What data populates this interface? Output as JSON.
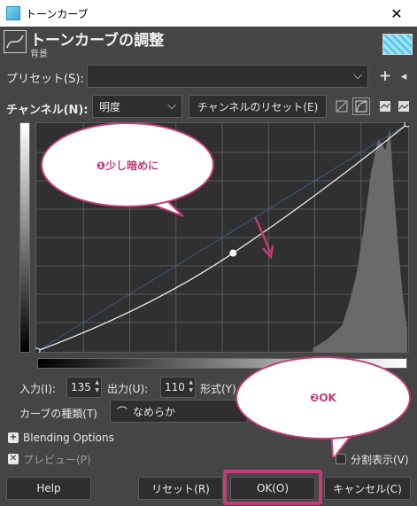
{
  "window": {
    "title": "トーンカーブ",
    "close_glyph": "✕"
  },
  "header": {
    "title": "トーンカーブの調整",
    "subtitle": "背景"
  },
  "presets": {
    "label": "プリセット(S):",
    "value": "",
    "add_glyph": "+",
    "menu_glyph": "◂"
  },
  "channel": {
    "label": "チャンネル(N):",
    "value": "明度",
    "reset_label": "チャンネルのリセット(E)"
  },
  "io": {
    "input_label": "入力(I):",
    "input_value": "135",
    "output_label": "出力(U):",
    "output_value": "110",
    "format_label": "形式(Y)"
  },
  "curve_type": {
    "label": "カーブの種類(T)",
    "value": "なめらか"
  },
  "blending": {
    "label": "Blending Options"
  },
  "preview": {
    "label": "プレビュー(P)",
    "checked": true
  },
  "split_view": {
    "label": "分割表示(V)",
    "checked": false
  },
  "buttons": {
    "help": "Help",
    "reset": "リセット(R)",
    "ok": "OK(O)",
    "cancel": "キャンセル(C)"
  },
  "annotations": {
    "bubble1": "❶少し暗めに",
    "bubble2": "❷OK"
  },
  "colors": {
    "accent": "#c23d76",
    "dialog_bg": "#454545",
    "widget_bg": "#2e2e2e"
  },
  "chart_data": {
    "type": "line",
    "title": "",
    "xlabel": "",
    "ylabel": "",
    "xlim": [
      0,
      255
    ],
    "ylim": [
      0,
      255
    ],
    "grid": true,
    "series": [
      {
        "values": [
          [
            0,
            0
          ],
          [
            135,
            110
          ],
          [
            255,
            255
          ]
        ]
      }
    ],
    "selected_point": [
      135,
      110
    ],
    "histogram": {
      "x": [
        190,
        200,
        210,
        215,
        220,
        225,
        230,
        235,
        240,
        243,
        246,
        249,
        252,
        255
      ],
      "values": [
        0.02,
        0.06,
        0.12,
        0.22,
        0.35,
        0.55,
        0.8,
        0.95,
        0.9,
        1.0,
        0.7,
        0.45,
        0.25,
        0.1
      ]
    }
  }
}
